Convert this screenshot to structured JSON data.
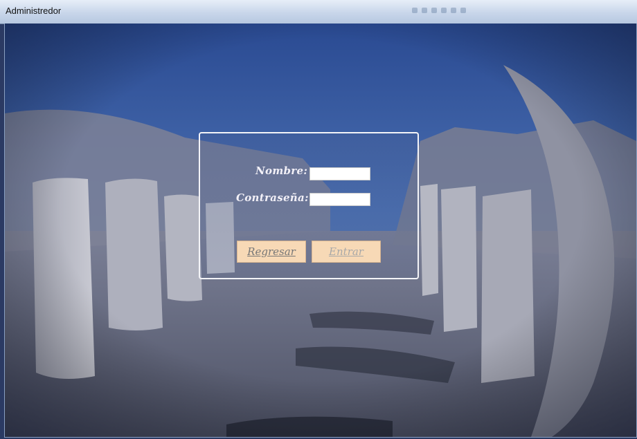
{
  "window": {
    "title": "Administredor"
  },
  "login": {
    "nombre_label": "Nombre:",
    "password_label": "Contraseña:",
    "nombre_value": "",
    "password_value": "",
    "back_button": "Regresar",
    "enter_button": "Entrar"
  },
  "colors": {
    "button_bg": "#f7d9b6",
    "panel_border": "#f4f4f8",
    "sky": "#2f4f96"
  }
}
